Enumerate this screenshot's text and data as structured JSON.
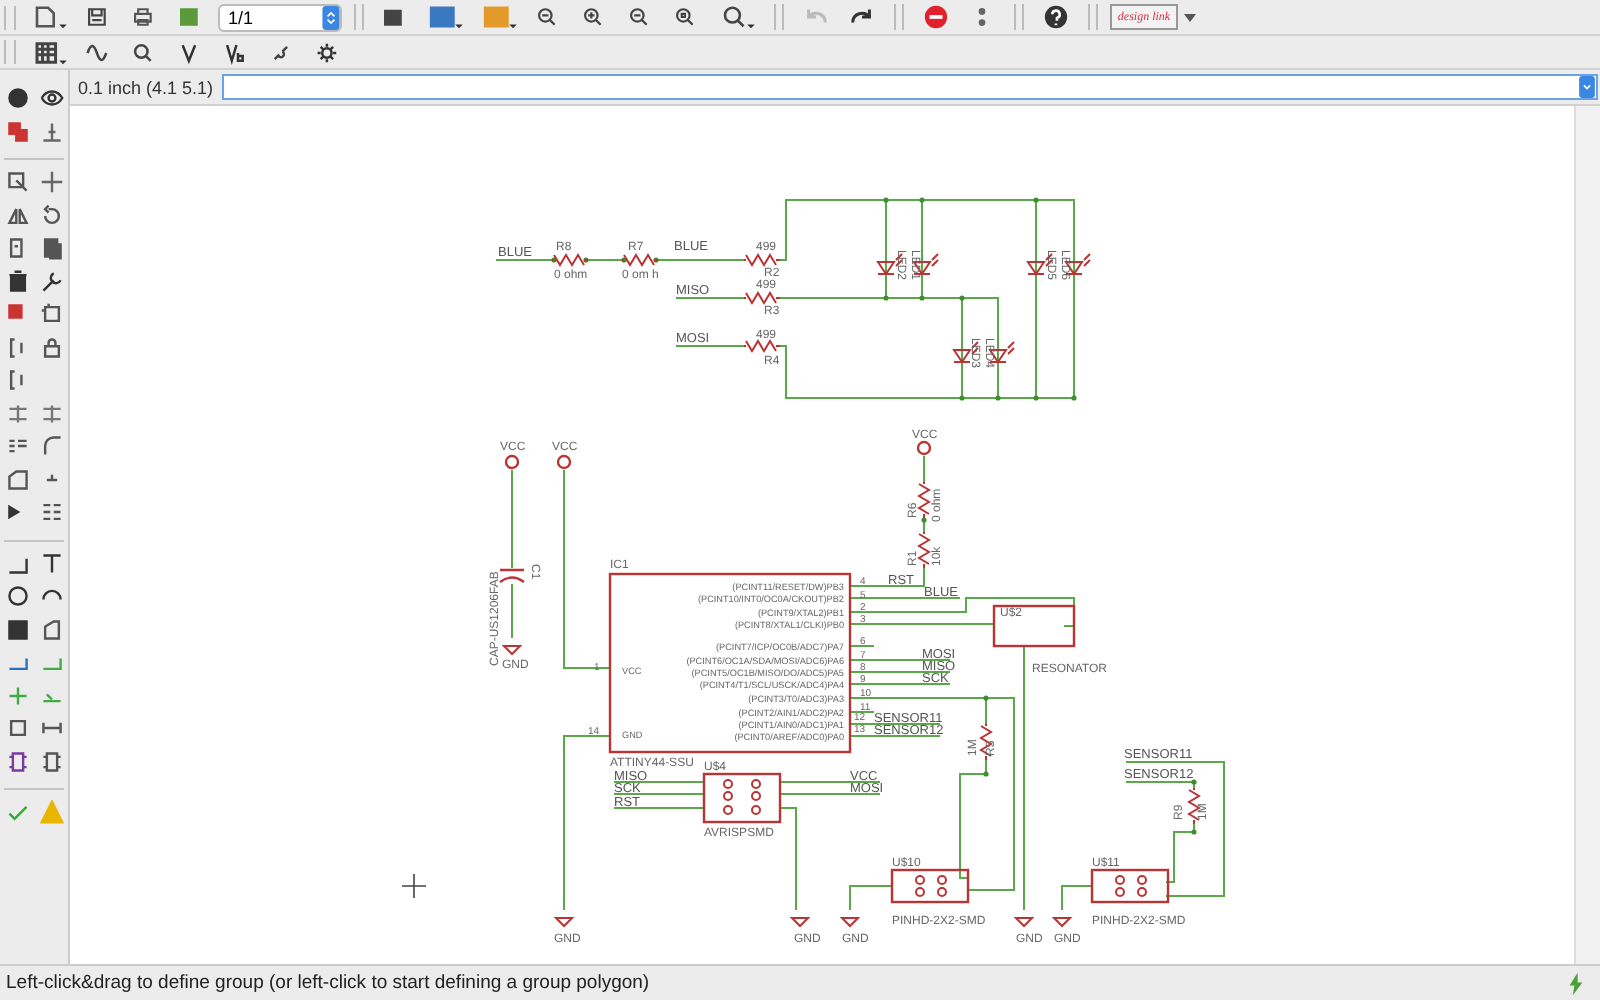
{
  "toolbar": {
    "page": "1/1",
    "logo": "design link",
    "history": [
      {
        "kind": "undo",
        "disabled": true
      },
      {
        "kind": "redo",
        "disabled": false
      }
    ]
  },
  "command_bar": {
    "grid_readout": "0.1 inch (4.1 5.1)"
  },
  "schematic": {
    "texts": [
      {
        "text": "BLUE",
        "kind": "label"
      },
      {
        "text": "R8",
        "kind": "part"
      },
      {
        "text": "0 ohm",
        "kind": "value"
      },
      {
        "text": "R7",
        "kind": "part"
      },
      {
        "text": "0 om h",
        "kind": "value"
      },
      {
        "text": "BLUE",
        "kind": "label"
      },
      {
        "text": "499",
        "kind": "value"
      },
      {
        "text": "R2",
        "kind": "part"
      },
      {
        "text": "MISO",
        "kind": "label"
      },
      {
        "text": "499",
        "kind": "value"
      },
      {
        "text": "R3",
        "kind": "part"
      },
      {
        "text": "MOSI",
        "kind": "label"
      },
      {
        "text": "499",
        "kind": "value"
      },
      {
        "text": "R4",
        "kind": "part"
      },
      {
        "text": "LED2",
        "kind": "part"
      },
      {
        "text": "LED1",
        "kind": "part"
      },
      {
        "text": "LED5",
        "kind": "part"
      },
      {
        "text": "LED6",
        "kind": "part"
      },
      {
        "text": "LED3",
        "kind": "part"
      },
      {
        "text": "LED4",
        "kind": "part"
      },
      {
        "text": "VCC",
        "kind": "power"
      },
      {
        "text": "VCC",
        "kind": "power"
      },
      {
        "text": "C1",
        "kind": "part"
      },
      {
        "text": "CAP-US1206FAB",
        "kind": "value"
      },
      {
        "text": "GND",
        "kind": "power"
      },
      {
        "text": "VCC",
        "kind": "power"
      },
      {
        "text": "R6",
        "kind": "part"
      },
      {
        "text": "0 ohm",
        "kind": "value"
      },
      {
        "text": "R1",
        "kind": "part"
      },
      {
        "text": "10k",
        "kind": "value"
      },
      {
        "text": "IC1",
        "kind": "part"
      },
      {
        "text": "(PCINT11/RESET/DW)PB3",
        "kind": "pin"
      },
      {
        "text": "(PCINT10/INT0/OC0A/CKOUT)PB2",
        "kind": "pin"
      },
      {
        "text": "(PCINT9/XTAL2)PB1",
        "kind": "pin"
      },
      {
        "text": "(PCINT8/XTAL1/CLKI)PB0",
        "kind": "pin"
      },
      {
        "text": "(PCINT7/ICP/OC0B/ADC7)PA7",
        "kind": "pin"
      },
      {
        "text": "(PCINT6/OC1A/SDA/MOSI/ADC6)PA6",
        "kind": "pin"
      },
      {
        "text": "(PCINT5/OC1B/MISO/DO/ADC5)PA5",
        "kind": "pin"
      },
      {
        "text": "(PCINT4/T1/SCL/USCK/ADC4)PA4",
        "kind": "pin"
      },
      {
        "text": "(PCINT3/T0/ADC3)PA3",
        "kind": "pin"
      },
      {
        "text": "(PCINT2/AIN1/ADC2)PA2",
        "kind": "pin"
      },
      {
        "text": "(PCINT1/AIN0/ADC1)PA1",
        "kind": "pin"
      },
      {
        "text": "(PCINT0/AREF/ADC0)PA0",
        "kind": "pin"
      },
      {
        "text": "4",
        "kind": "pinnum"
      },
      {
        "text": "5",
        "kind": "pinnum"
      },
      {
        "text": "2",
        "kind": "pinnum"
      },
      {
        "text": "3",
        "kind": "pinnum"
      },
      {
        "text": "6",
        "kind": "pinnum"
      },
      {
        "text": "7",
        "kind": "pinnum"
      },
      {
        "text": "8",
        "kind": "pinnum"
      },
      {
        "text": "9",
        "kind": "pinnum"
      },
      {
        "text": "10",
        "kind": "pinnum"
      },
      {
        "text": "11",
        "kind": "pinnum"
      },
      {
        "text": "12",
        "kind": "pinnum"
      },
      {
        "text": "13",
        "kind": "pinnum"
      },
      {
        "text": "VCC",
        "kind": "pin"
      },
      {
        "text": "GND",
        "kind": "pin"
      },
      {
        "text": "1",
        "kind": "pinnum"
      },
      {
        "text": "14",
        "kind": "pinnum"
      },
      {
        "text": "ATTINY44-SSU",
        "kind": "value"
      },
      {
        "text": "RST",
        "kind": "label"
      },
      {
        "text": "BLUE",
        "kind": "label"
      },
      {
        "text": "U$2",
        "kind": "part"
      },
      {
        "text": "RESONATOR",
        "kind": "value"
      },
      {
        "text": "MOSI",
        "kind": "label"
      },
      {
        "text": "MISO",
        "kind": "label"
      },
      {
        "text": "SCK",
        "kind": "label"
      },
      {
        "text": "SENSOR11",
        "kind": "label"
      },
      {
        "text": "SENSOR12",
        "kind": "label"
      },
      {
        "text": "1M",
        "kind": "value"
      },
      {
        "text": "R5",
        "kind": "part"
      },
      {
        "text": "U$4",
        "kind": "part"
      },
      {
        "text": "MISO",
        "kind": "label"
      },
      {
        "text": "SCK",
        "kind": "label"
      },
      {
        "text": "RST",
        "kind": "label"
      },
      {
        "text": "VCC",
        "kind": "label"
      },
      {
        "text": "MOSI",
        "kind": "label"
      },
      {
        "text": "AVRISPSMD",
        "kind": "value"
      },
      {
        "text": "U$10",
        "kind": "part"
      },
      {
        "text": "PINHD-2X2-SMD",
        "kind": "value"
      },
      {
        "text": "U$11",
        "kind": "part"
      },
      {
        "text": "PINHD-2X2-SMD",
        "kind": "value"
      },
      {
        "text": "SENSOR11",
        "kind": "label"
      },
      {
        "text": "SENSOR12",
        "kind": "label"
      },
      {
        "text": "R9",
        "kind": "part"
      },
      {
        "text": "1M",
        "kind": "value"
      },
      {
        "text": "GND",
        "kind": "power"
      },
      {
        "text": "GND",
        "kind": "power"
      },
      {
        "text": "GND",
        "kind": "power"
      },
      {
        "text": "GND",
        "kind": "power"
      },
      {
        "text": "GND",
        "kind": "power"
      }
    ]
  },
  "status_bar": {
    "message": "Left-click&drag to define group (or left-click to start defining a group polygon)"
  }
}
